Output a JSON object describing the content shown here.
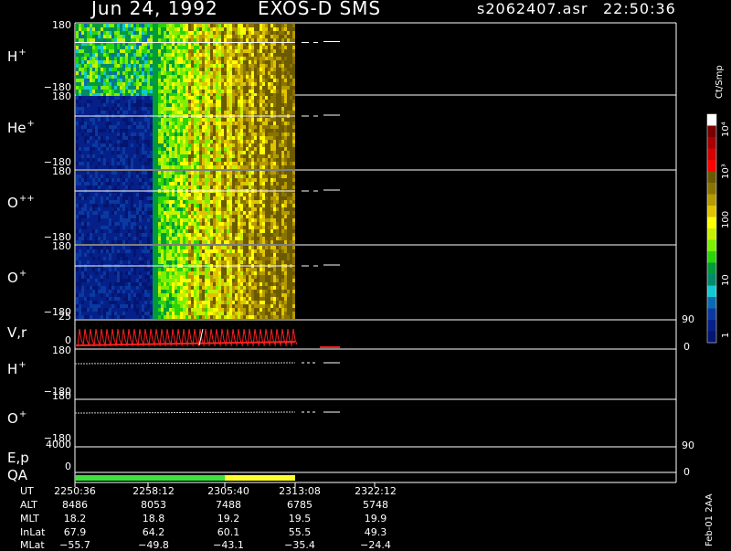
{
  "header": {
    "date": "Jun 24, 1992",
    "mission": "EXOS-D SMS",
    "file": "s2062407.asr",
    "time": "22:50:36"
  },
  "panels": [
    {
      "label": "H",
      "sup": "+",
      "ytop": "180",
      "ybot": "−180"
    },
    {
      "label": "He",
      "sup": "+",
      "ytop": "180",
      "ybot": "−180"
    },
    {
      "label": "O",
      "sup": "++",
      "ytop": "180",
      "ybot": "−180"
    },
    {
      "label": "O",
      "sup": "+",
      "ytop": "180",
      "ybot": "−180"
    },
    {
      "label": "V,r",
      "sup": "",
      "ytop": "25",
      "ybot": "0",
      "rtop": "90",
      "rbot": "0"
    },
    {
      "label": "H",
      "sup": "+",
      "ytop": "180",
      "ybot": "−180"
    },
    {
      "label": "O",
      "sup": "+",
      "ytop": "180",
      "ybot": "−180"
    },
    {
      "label": "E,p",
      "sup": "",
      "ytop": "4000",
      "ybot": "",
      "rtop": "90"
    },
    {
      "label": "QA",
      "sup": "",
      "ytop": "",
      "ybot": "0",
      "rbot": "0"
    }
  ],
  "colorbar": {
    "title": "Ct/Smp",
    "labels": [
      "10⁴",
      "10³",
      "100",
      "10",
      "1"
    ],
    "colors": [
      "#ffffff",
      "#7a0000",
      "#a80000",
      "#d40000",
      "#ff0000",
      "#6b5a00",
      "#8a7400",
      "#b59a00",
      "#e0c400",
      "#ffff00",
      "#c8f000",
      "#7cf000",
      "#2bd40a",
      "#009b3a",
      "#008a6a",
      "#13c8d0",
      "#0a6ab4",
      "#0a3aa0",
      "#06208a",
      "#041570"
    ]
  },
  "chart_data": {
    "type": "heatmap",
    "title": "Jun 24, 1992 EXOS-D SMS",
    "x_label": "UT",
    "ephemeris": {
      "rows": [
        "UT",
        "ALT",
        "MLT",
        "InLat",
        "MLat"
      ],
      "UT": [
        "2250:36",
        "2258:12",
        "2305:40",
        "2313:08",
        "2322:12"
      ],
      "ALT": [
        "8486",
        "8053",
        "7488",
        "6785",
        "5748"
      ],
      "MLT": [
        "18.2",
        "18.8",
        "19.2",
        "19.5",
        "19.9"
      ],
      "InLat": [
        "67.9",
        "64.2",
        "60.1",
        "55.5",
        "49.3"
      ],
      "MLat": [
        "−55.7",
        "−49.8",
        "−43.1",
        "−35.4",
        "−24.4"
      ]
    },
    "series": [
      {
        "name": "H+",
        "range": [
          -180,
          180
        ]
      },
      {
        "name": "He+",
        "range": [
          -180,
          180
        ]
      },
      {
        "name": "O++",
        "range": [
          -180,
          180
        ]
      },
      {
        "name": "O+",
        "range": [
          -180,
          180
        ]
      },
      {
        "name": "V,r",
        "range": [
          0,
          25
        ],
        "right_range": [
          0,
          90
        ]
      },
      {
        "name": "H+",
        "range": [
          -180,
          180
        ]
      },
      {
        "name": "O+",
        "range": [
          -180,
          180
        ]
      },
      {
        "name": "E,p",
        "range": [
          0,
          4000
        ],
        "right_range": [
          0,
          90
        ]
      },
      {
        "name": "QA"
      }
    ],
    "colorbar_scale": "log",
    "colorbar_range": [
      1,
      10000
    ]
  },
  "footer": {
    "rotated": "Feb-01 2AA"
  }
}
